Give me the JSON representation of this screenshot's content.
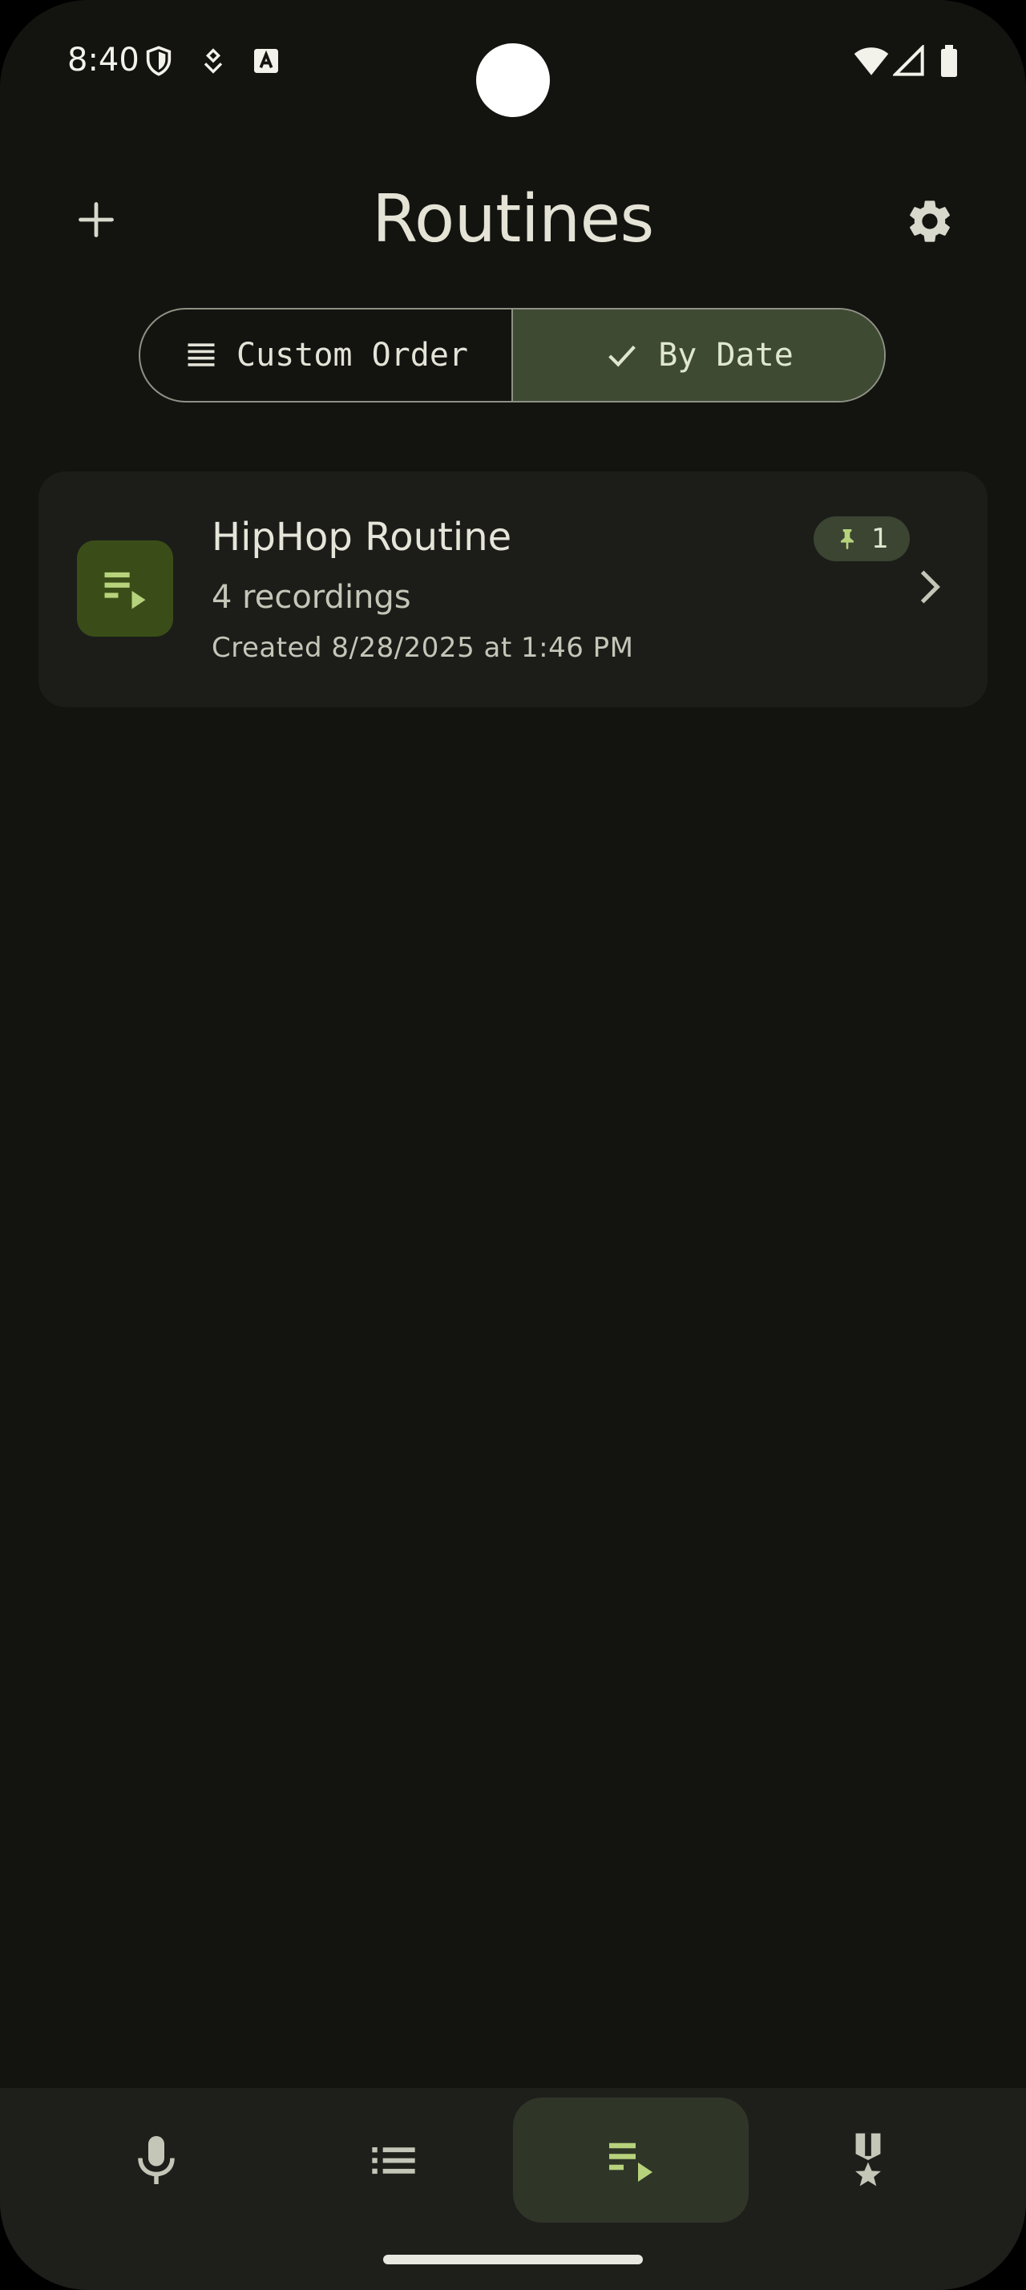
{
  "status_bar": {
    "time": "8:40",
    "icons": [
      "shield-icon",
      "location-pin-icon",
      "text-a-icon",
      "wifi-icon",
      "cell-signal-icon",
      "battery-icon"
    ]
  },
  "header": {
    "title": "Routines",
    "add_icon": "plus-icon",
    "settings_icon": "gear-icon"
  },
  "sort_toggle": {
    "options": [
      {
        "label": "Custom Order",
        "icon": "list-lines-icon",
        "selected": false
      },
      {
        "label": "By Date",
        "icon": "check-icon",
        "selected": true
      }
    ]
  },
  "routines": [
    {
      "title": "HipHop Routine",
      "count": "4 recordings",
      "created": "Created 8/28/2025 at 1:46 PM",
      "pinned_count": "1",
      "icon": "playlist-play-icon"
    }
  ],
  "bottom_nav": {
    "items": [
      {
        "name": "record",
        "icon": "microphone-icon",
        "active": false
      },
      {
        "name": "list",
        "icon": "list-icon",
        "active": false
      },
      {
        "name": "routines",
        "icon": "playlist-play-icon",
        "active": true
      },
      {
        "name": "achievements",
        "icon": "medal-icon",
        "active": false
      }
    ]
  },
  "colors": {
    "background": "#131410",
    "card": "#1c1d19",
    "accent": "#b7d27c",
    "selected_segment": "#3f4a33",
    "thumb": "#3a4d18"
  }
}
